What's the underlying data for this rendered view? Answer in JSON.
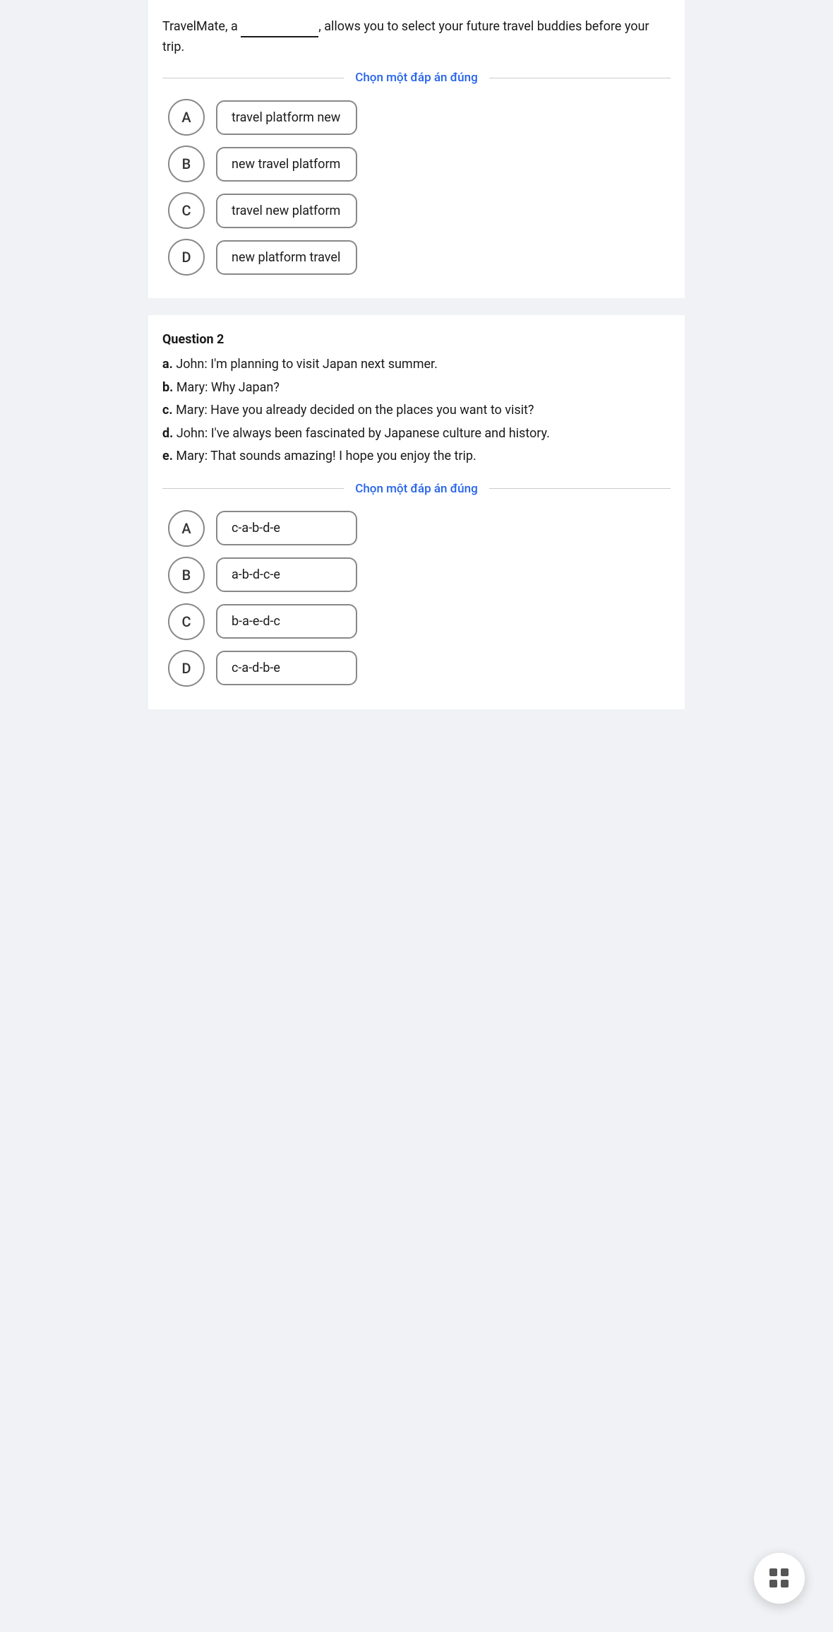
{
  "question1": {
    "intro_before": "TravelMate, a ",
    "blank": "___________",
    "intro_after": ", allows you to select your future travel buddies before your trip.",
    "choose_label": "Chọn một đáp án đúng",
    "options": [
      {
        "id": "A",
        "text": "travel platform new"
      },
      {
        "id": "B",
        "text": "new travel platform"
      },
      {
        "id": "C",
        "text": "travel new platform"
      },
      {
        "id": "D",
        "text": "new platform travel"
      }
    ]
  },
  "question2": {
    "label": "Question 2",
    "lines": [
      {
        "letter": "a",
        "text": "John: I'm planning to visit Japan next summer."
      },
      {
        "letter": "b",
        "text": "Mary: Why Japan?"
      },
      {
        "letter": "c",
        "text": "Mary: Have you already decided on the places you want to visit?"
      },
      {
        "letter": "d",
        "text": "John: I've always been fascinated by Japanese culture and history."
      },
      {
        "letter": "e",
        "text": "Mary: That sounds amazing! I hope you enjoy the trip."
      }
    ],
    "choose_label": "Chọn một đáp án đúng",
    "options": [
      {
        "id": "A",
        "text": "c-a-b-d-e"
      },
      {
        "id": "B",
        "text": "a-b-d-c-e"
      },
      {
        "id": "C",
        "text": "b-a-e-d-c"
      },
      {
        "id": "D",
        "text": "c-a-d-b-e"
      }
    ]
  },
  "fab": {
    "label": "grid-icon"
  }
}
